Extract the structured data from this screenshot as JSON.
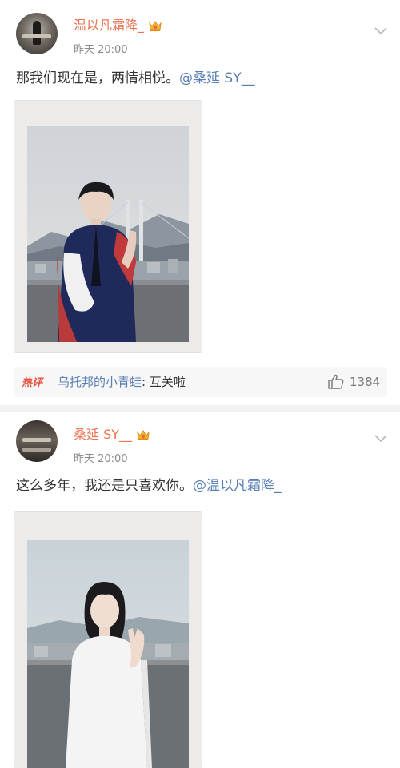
{
  "posts": [
    {
      "username": "温以凡霜降_",
      "time": "昨天 20:00",
      "text": "那我们现在是，两情相悦。",
      "mention": "@桑延 SY__",
      "hot_comment": {
        "tag": "热评",
        "user": "乌托邦的小青蛙",
        "separator": ": ",
        "text": "互关啦",
        "likes": "1384"
      }
    },
    {
      "username": "桑延 SY__",
      "time": "昨天 20:00",
      "text": "这么多年，我还是只喜欢你。",
      "mention": "@温以凡霜降_"
    }
  ],
  "icons": {
    "vip_badge": "crown-vip-badge-icon",
    "menu": "chevron-down-icon",
    "like": "thumbs-up-icon"
  },
  "colors": {
    "username": "#eb7350",
    "mention": "#5a7fb5",
    "hot_tag": "#e5503f",
    "meta": "#8a8a8a"
  }
}
